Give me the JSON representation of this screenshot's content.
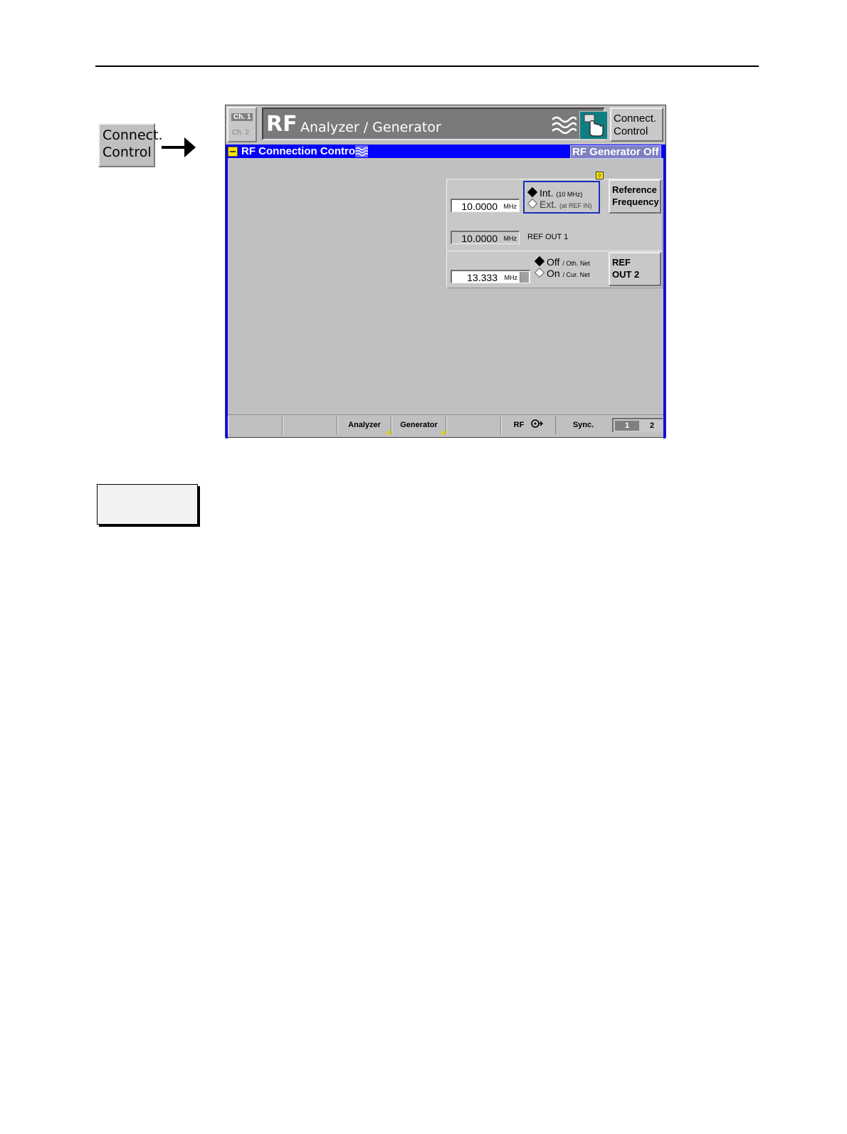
{
  "side_button": {
    "line1": "Connect.",
    "line2": "Control"
  },
  "header": {
    "ch1": "Ch. 1",
    "ch2": "Ch. 2",
    "title": "RF",
    "subtitle": "Analyzer / Generator",
    "connect_control": {
      "line1": "Connect.",
      "line2": "Control"
    }
  },
  "status_bar": {
    "menu_title": "RF Connection Control",
    "generator_status": "RF Generator Off"
  },
  "reference": {
    "value": "10.0000",
    "unit": "MHz",
    "int_label": "Int.",
    "int_note": "(10 MHz)",
    "ext_label": "Ext.",
    "ext_note": "(at REF IN)",
    "selected": "Int.",
    "button": {
      "line1": "Reference",
      "line2": "Frequency"
    }
  },
  "ref_out1": {
    "value": "10.0000",
    "unit": "MHz",
    "label": "REF OUT 1"
  },
  "ref_out2": {
    "value": "13.333",
    "unit": "MHz",
    "off_label": "Off",
    "off_note": "/ Oth. Net",
    "on_label": "On",
    "on_note": "/ Cur. Net",
    "selected": "Off",
    "button": {
      "line1": "REF",
      "line2": "OUT 2"
    }
  },
  "softkeys": {
    "analyzer": "Analyzer",
    "generator": "Generator",
    "rf": "RF",
    "sync": "Sync.",
    "sync_1": "1",
    "sync_2": "2"
  },
  "icons": [
    "rf-wave-icon",
    "hand-touch-icon",
    "menu-icon",
    "rf-connector-icon",
    "arrow-right-icon"
  ],
  "colors": {
    "accent_blue": "#0000ff",
    "frame_grey": "#c0c0c0",
    "hand_teal": "#0f7e80",
    "marker_yellow": "#ffe800"
  }
}
